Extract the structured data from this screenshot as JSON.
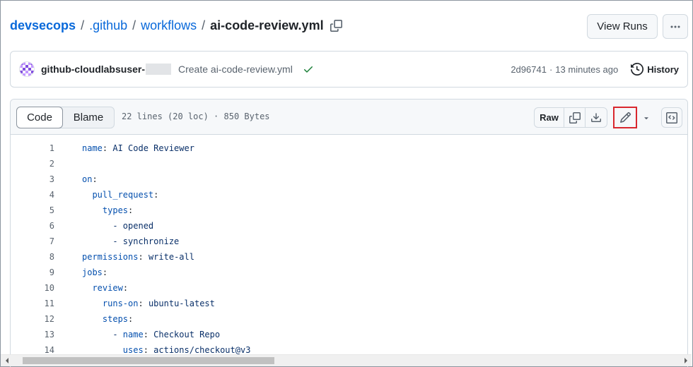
{
  "breadcrumb": {
    "repo": "devsecops",
    "folder1": ".github",
    "folder2": "workflows",
    "file": "ai-code-review.yml",
    "separator": "/"
  },
  "header_actions": {
    "view_runs_label": "View Runs"
  },
  "commit": {
    "author": "github-cloudlabsuser-",
    "message": "Create ai-code-review.yml",
    "sha": "2d96741",
    "age": "13 minutes ago",
    "separator": "·",
    "history_label": "History"
  },
  "file_header": {
    "tabs": [
      {
        "label": "Code",
        "selected": true
      },
      {
        "label": "Blame",
        "selected": false
      }
    ],
    "meta": "22 lines (20 loc) · 850 Bytes",
    "raw_label": "Raw"
  },
  "code_lines": [
    {
      "n": "1",
      "indent": "",
      "key": "name",
      "value": " AI Code Reviewer"
    },
    {
      "n": "2",
      "indent": "",
      "key": "",
      "value": ""
    },
    {
      "n": "3",
      "indent": "",
      "key": "on",
      "value": ""
    },
    {
      "n": "4",
      "indent": "  ",
      "key": "pull_request",
      "value": ""
    },
    {
      "n": "5",
      "indent": "    ",
      "key": "types",
      "value": ""
    },
    {
      "n": "6",
      "indent": "      ",
      "key": "",
      "value": "- opened"
    },
    {
      "n": "7",
      "indent": "      ",
      "key": "",
      "value": "- synchronize"
    },
    {
      "n": "8",
      "indent": "",
      "key": "permissions",
      "value": " write-all"
    },
    {
      "n": "9",
      "indent": "",
      "key": "jobs",
      "value": ""
    },
    {
      "n": "10",
      "indent": "  ",
      "key": "review",
      "value": ""
    },
    {
      "n": "11",
      "indent": "    ",
      "key": "runs-on",
      "value": " ubuntu-latest"
    },
    {
      "n": "12",
      "indent": "    ",
      "key": "steps",
      "value": ""
    },
    {
      "n": "13",
      "indent": "      - ",
      "key": "name",
      "value": " Checkout Repo"
    },
    {
      "n": "14",
      "indent": "        ",
      "key": "uses",
      "value": " actions/checkout@v3"
    }
  ],
  "colors": {
    "link": "#0969da",
    "success": "#1a7f37",
    "highlight_box": "#d9272e",
    "yaml_key": "#0550ae",
    "yaml_value": "#0a3069"
  },
  "icons": {
    "copy_path": "copy-icon",
    "more": "kebab-horizontal-icon",
    "avatar": "identicon-avatar",
    "check": "check-icon",
    "history": "history-icon",
    "copy_raw": "copy-icon",
    "download": "download-icon",
    "edit": "pencil-icon",
    "caret": "triangle-down-icon",
    "symbols": "code-square-icon"
  }
}
